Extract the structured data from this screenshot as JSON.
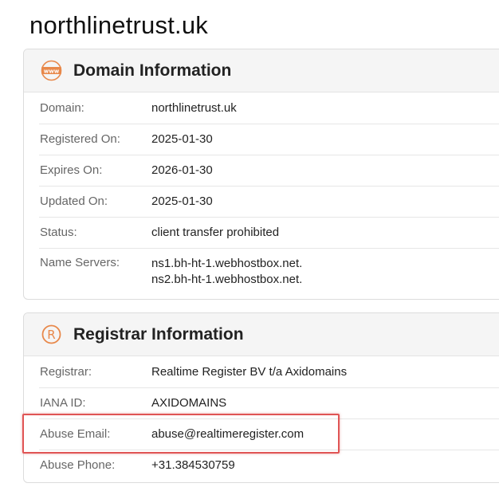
{
  "page_title": "northlinetrust.uk",
  "domain_card": {
    "title": "Domain Information",
    "icon": "www-globe-icon",
    "rows": [
      {
        "label": "Domain:",
        "value": "northlinetrust.uk"
      },
      {
        "label": "Registered On:",
        "value": "2025-01-30"
      },
      {
        "label": "Expires On:",
        "value": "2026-01-30"
      },
      {
        "label": "Updated On:",
        "value": "2025-01-30"
      },
      {
        "label": "Status:",
        "value": "client transfer prohibited"
      },
      {
        "label": "Name Servers:",
        "values": [
          "ns1.bh-ht-1.webhostbox.net.",
          "ns2.bh-ht-1.webhostbox.net."
        ]
      }
    ]
  },
  "registrar_card": {
    "title": "Registrar Information",
    "icon": "registered-trademark-icon",
    "rows": [
      {
        "label": "Registrar:",
        "value": "Realtime Register BV t/a Axidomains"
      },
      {
        "label": "IANA ID:",
        "value": "AXIDOMAINS"
      },
      {
        "label": "Abuse Email:",
        "value": "abuse@realtimeregister.com"
      },
      {
        "label": "Abuse Phone:",
        "value": "+31.384530759"
      }
    ]
  },
  "colors": {
    "accent": "#e8884a",
    "highlight": "#e05555"
  }
}
